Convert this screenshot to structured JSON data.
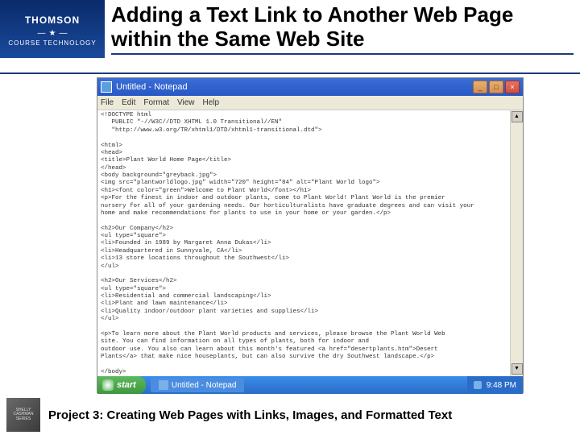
{
  "logo": {
    "brand": "THOMSON",
    "sub": "COURSE TECHNOLOGY",
    "star": "★"
  },
  "title": "Adding a Text Link to Another Web Page within the Same Web Site",
  "notepad": {
    "title": "Untitled - Notepad",
    "menu": [
      "File",
      "Edit",
      "Format",
      "View",
      "Help"
    ],
    "buttons": {
      "min": "_",
      "max": "□",
      "close": "×"
    },
    "content": "<!DOCTYPE html\n   PUBLIC \"-//W3C//DTD XHTML 1.0 Transitional//EN\"\n   \"http://www.w3.org/TR/xhtml1/DTD/xhtml1-transitional.dtd\">\n\n<html>\n<head>\n<title>Plant World Home Page</title>\n</head>\n<body background=\"greyback.jpg\">\n<img src=\"plantworldlogo.jpg\" width=\"720\" height=\"84\" alt=\"Plant World logo\">\n<h1><font color=\"green\">Welcome to Plant World</font></h1>\n<p>For the finest in indoor and outdoor plants, come to Plant World! Plant World is the premier\nnursery for all of your gardening needs. Our horticulturalists have graduate degrees and can visit your\nhome and make recommendations for plants to use in your home or your garden.</p>\n\n<h2>Our Company</h2>\n<ul type=\"square\">\n<li>Founded in 1989 by Margaret Anna Dukas</li>\n<li>Headquartered in Sunnyvale, CA</li>\n<li>13 store locations throughout the Southwest</li>\n</ul>\n\n<h2>Our Services</h2>\n<ul type=\"square\">\n<li>Residential and commercial landscaping</li>\n<li>Plant and lawn maintenance</li>\n<li>Quality indoor/outdoor plant varieties and supplies</li>\n</ul>\n\n<p>To learn more about the Plant World products and services, please browse the Plant World Web\nsite. You can find information on all types of plants, both for indoor and\noutdoor use. You also can learn about this month's featured <a href=\"desertplants.htm\">Desert\nPlants</a> that make nice houseplants, but can also survive the dry Southwest landscape.</p>\n\n</body>\n</html>"
  },
  "taskbar": {
    "start": "start",
    "task": "Untitled - Notepad",
    "time": "9:48 PM"
  },
  "footer": {
    "logo1": "SHELLY",
    "logo2": "CASHMAN",
    "logo3": "SERIES",
    "text": "Project 3: Creating Web Pages with Links, Images, and Formatted Text"
  }
}
